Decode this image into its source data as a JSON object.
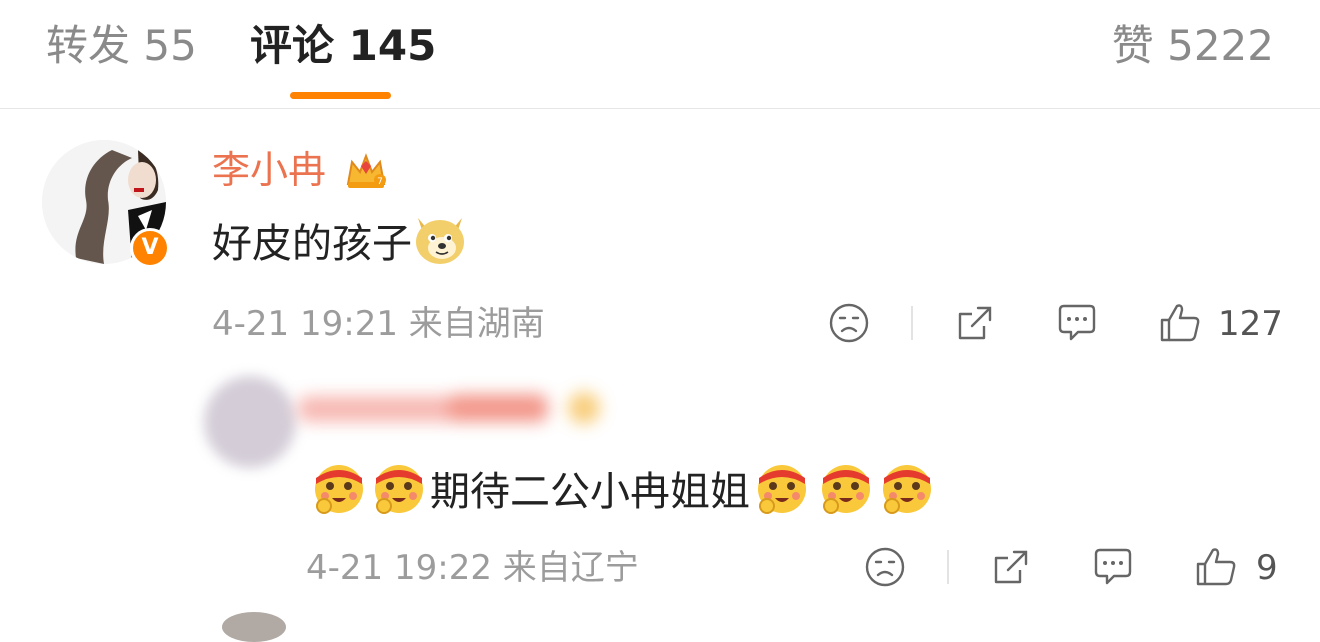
{
  "tabs": {
    "repost": "转发 55",
    "comments": "评论 145",
    "likes": "赞 5222",
    "accent": "#ff8200"
  },
  "comment": {
    "username": "李小冉",
    "badge_icon": "crown-icon",
    "verified_label": "V",
    "text": "好皮的孩子",
    "emoji": "doge-emoji",
    "meta": "4-21 19:21 来自湖南",
    "like_count": "127",
    "username_color": "#eb7350"
  },
  "reply": {
    "text": "期待二公小冉姐姐",
    "emoji": "cheer-emoji",
    "meta": "4-21 19:22 来自辽宁",
    "like_count": "9"
  }
}
